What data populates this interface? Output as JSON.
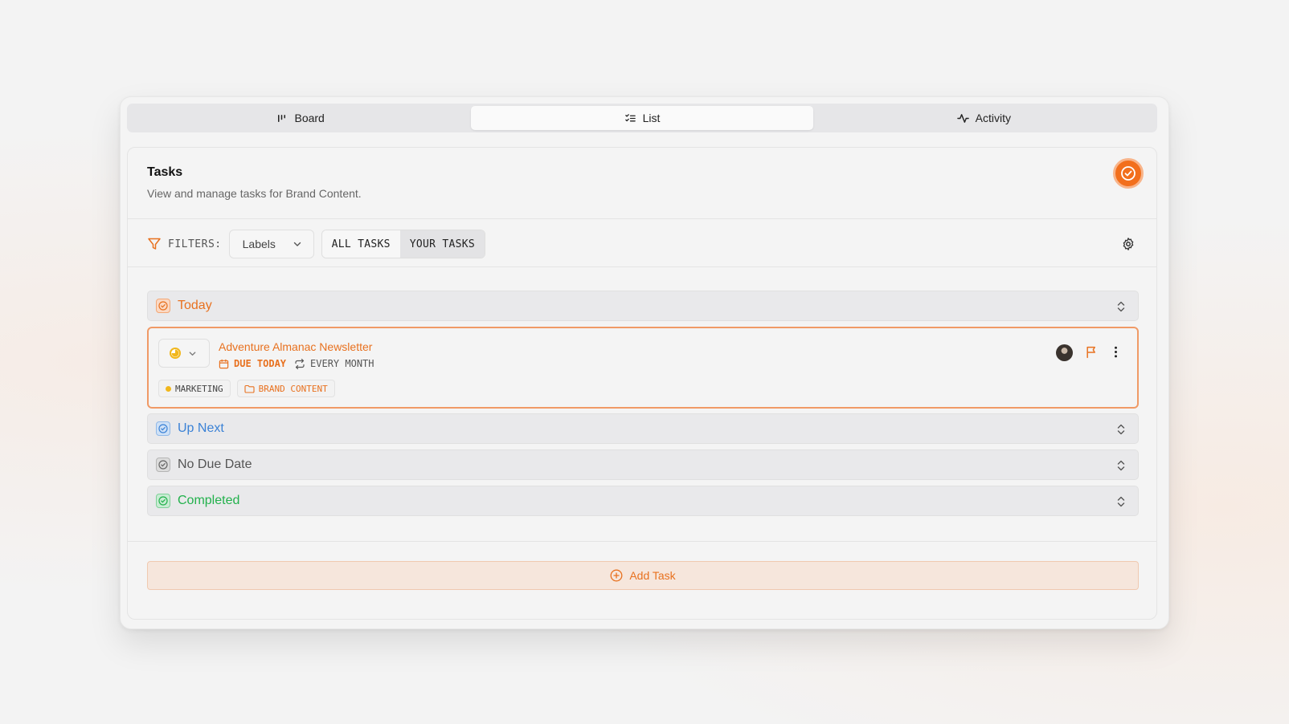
{
  "tabs": [
    {
      "label": "Board",
      "icon": "board-icon",
      "active": false
    },
    {
      "label": "List",
      "icon": "list-icon",
      "active": true
    },
    {
      "label": "Activity",
      "icon": "activity-icon",
      "active": false
    }
  ],
  "header": {
    "title": "Tasks",
    "subtitle": "View and manage tasks for Brand Content."
  },
  "filters": {
    "label": "FILTERS:",
    "labels_select": "Labels",
    "segments": [
      "ALL TASKS",
      "YOUR TASKS"
    ]
  },
  "groups": [
    {
      "label": "Today",
      "color": "#e8711f"
    },
    {
      "label": "Up Next",
      "color": "#3b82d6"
    },
    {
      "label": "No Due Date",
      "color": "#555555"
    },
    {
      "label": "Completed",
      "color": "#22b14c"
    }
  ],
  "task": {
    "title": "Adventure Almanac Newsletter",
    "due": "DUE TODAY",
    "repeat": "EVERY MONTH",
    "tags": [
      {
        "label": "MARKETING",
        "color": "#f1b71c"
      },
      {
        "label": "BRAND CONTENT",
        "color": "#e8711f"
      }
    ]
  },
  "add_task_label": "Add Task",
  "accent": "#f26f1c"
}
